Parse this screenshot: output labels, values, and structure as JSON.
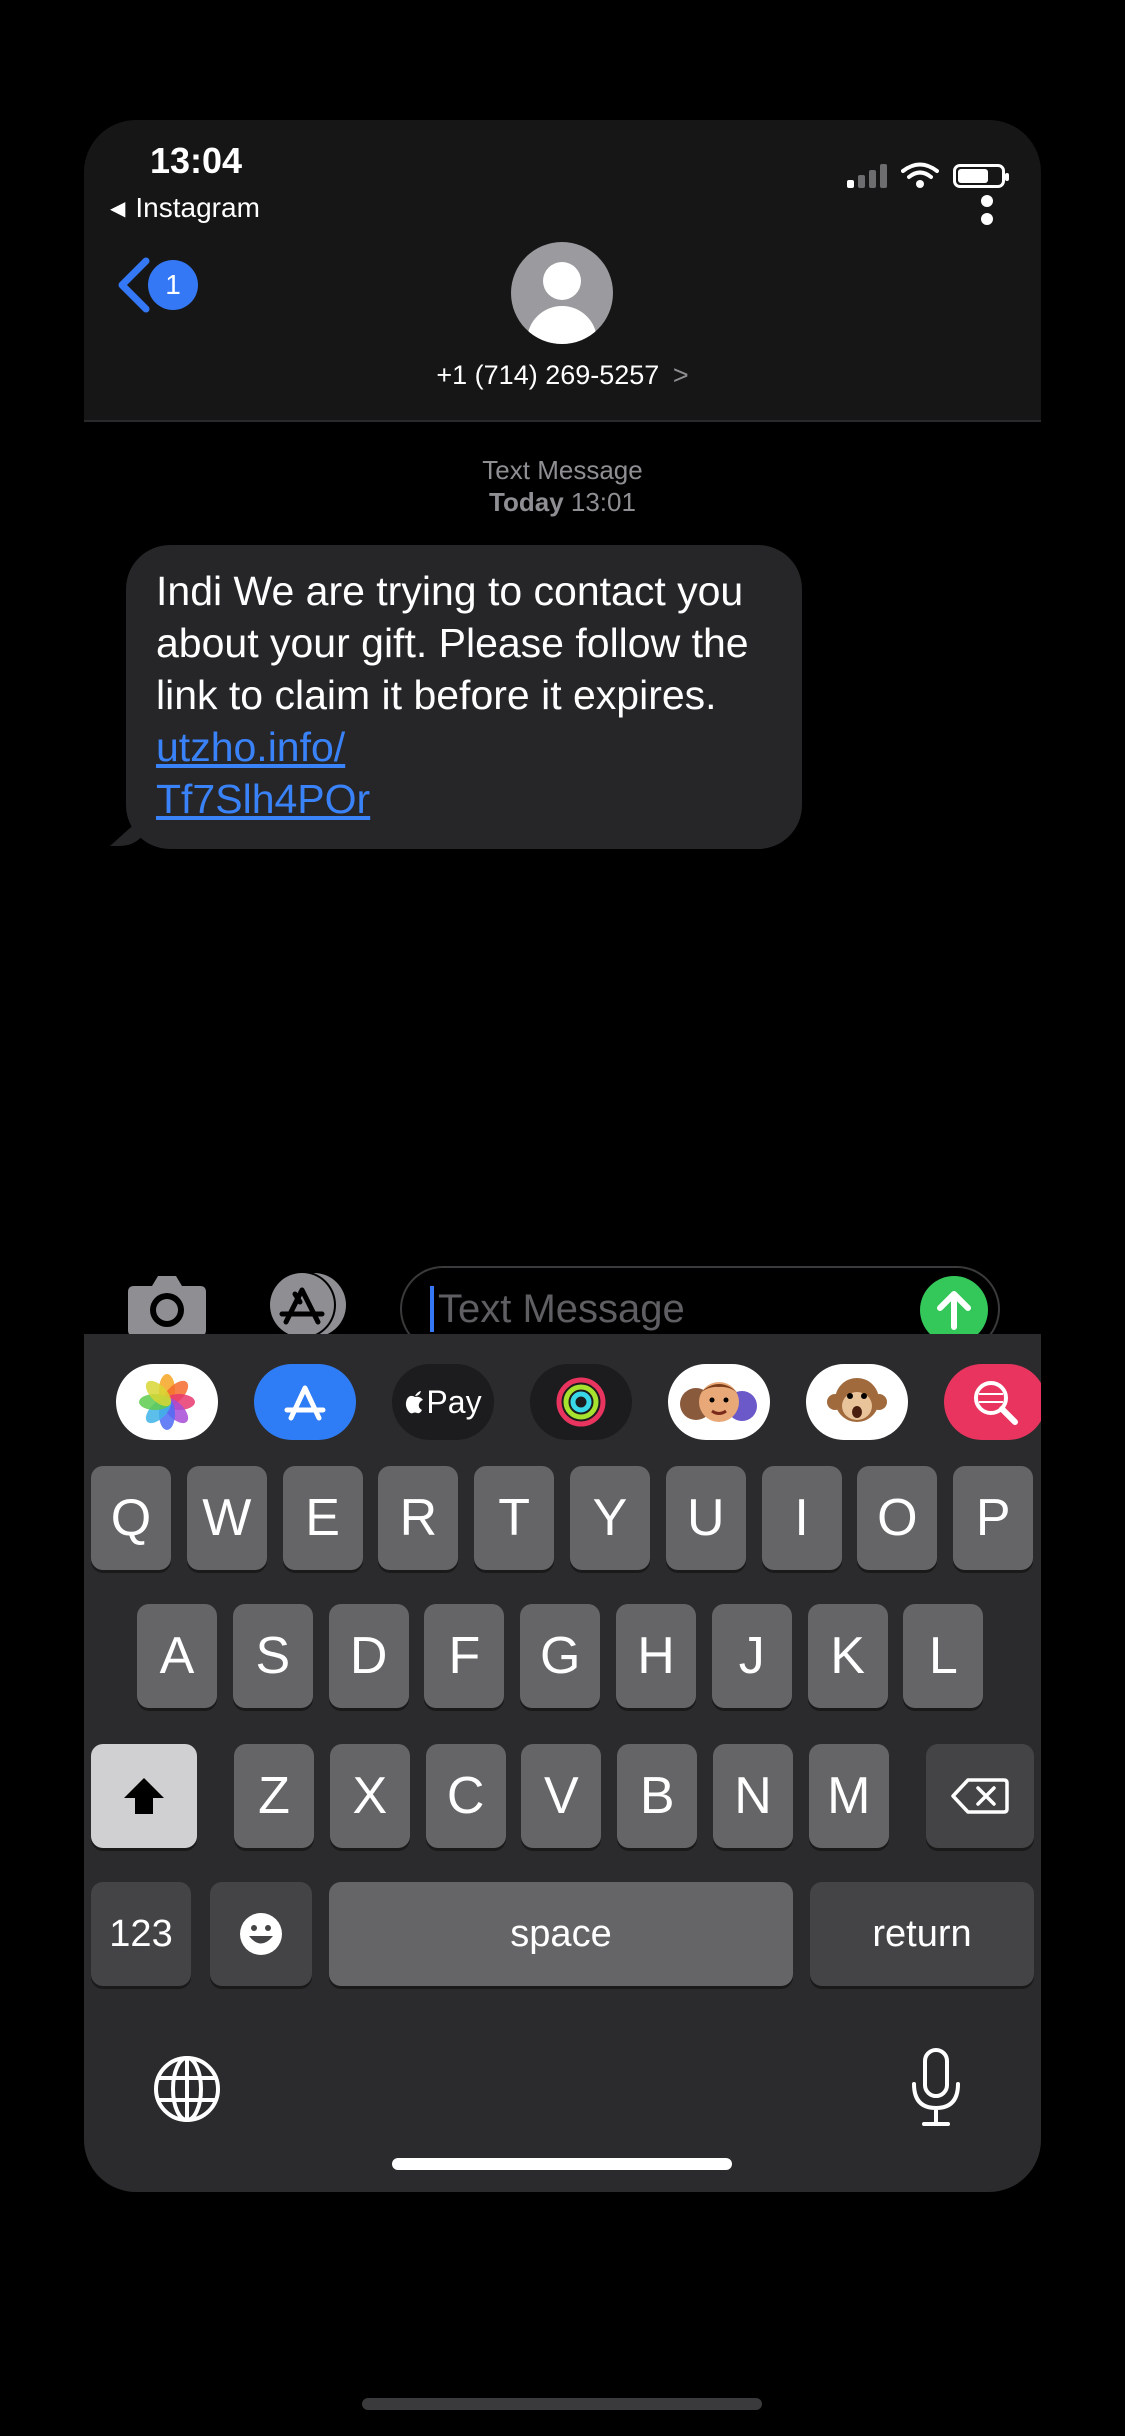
{
  "status_bar": {
    "time": "13:04",
    "back_app": "Instagram"
  },
  "header": {
    "unread_count": "1",
    "contact_number": "+1 (714) 269-5257",
    "contact_chevron": ">"
  },
  "conversation": {
    "service_label": "Text Message",
    "date_label": "Today",
    "time_label": "13:01",
    "message_text": "Indi We are trying to contact you about your gift. Please follow the link to claim it before it expires. ",
    "link_line1": "utzho.info/",
    "link_line2": "Tf7Slh4POr"
  },
  "composer": {
    "placeholder": "Text Message"
  },
  "app_strip": {
    "items": [
      "photos-app",
      "app-store",
      "apple-pay",
      "activity",
      "memoji",
      "animoji",
      "search-images"
    ],
    "apple_pay_label": "Pay"
  },
  "keyboard": {
    "row1": [
      "Q",
      "W",
      "E",
      "R",
      "T",
      "Y",
      "U",
      "I",
      "O",
      "P"
    ],
    "row2": [
      "A",
      "S",
      "D",
      "F",
      "G",
      "H",
      "J",
      "K",
      "L"
    ],
    "row3": [
      "Z",
      "X",
      "C",
      "V",
      "B",
      "N",
      "M"
    ],
    "numbers_label": "123",
    "space_label": "space",
    "return_label": "return"
  },
  "colors": {
    "accent": "#3478f6",
    "send": "#34c759",
    "bubble": "#262629",
    "link": "#3a82f7"
  }
}
